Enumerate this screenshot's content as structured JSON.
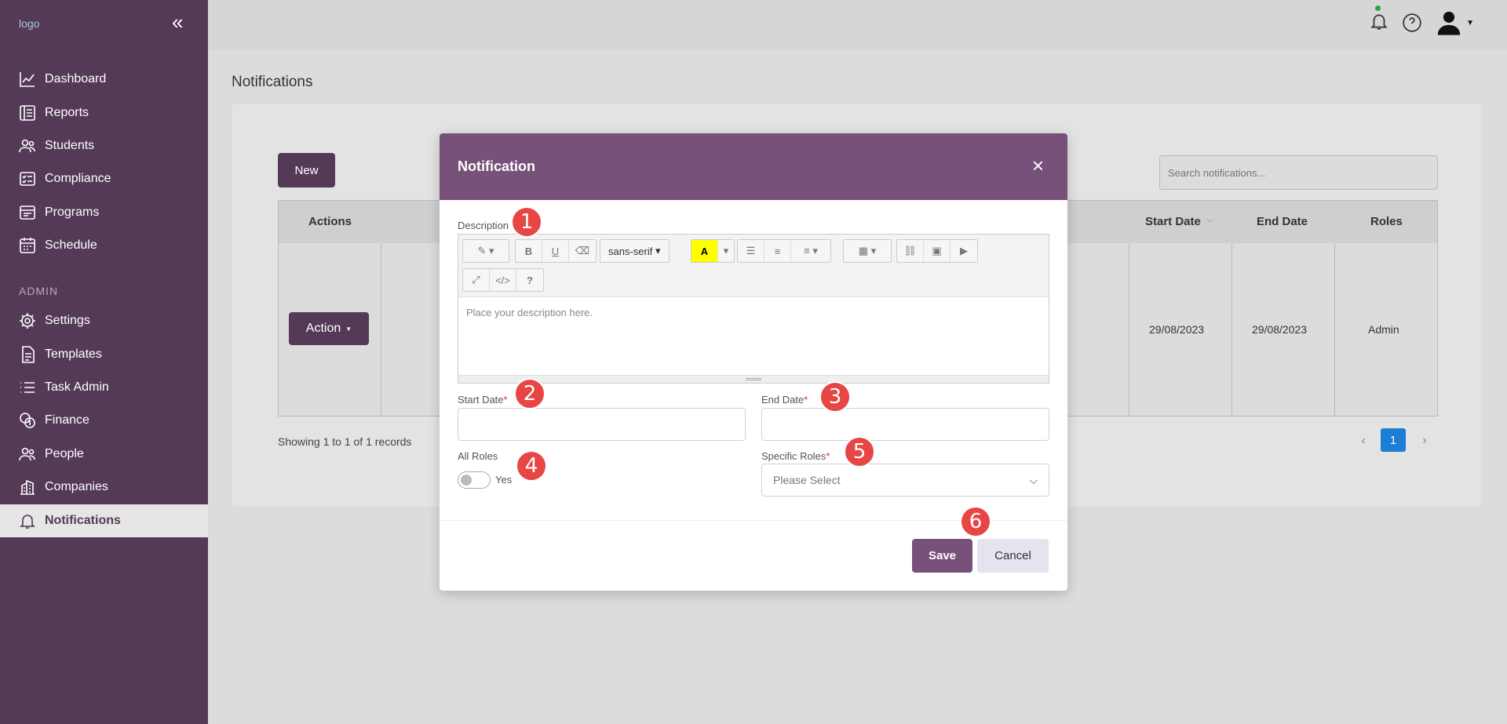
{
  "sidebar": {
    "logo_alt": "logo",
    "admin_label": "ADMIN",
    "items": [
      {
        "label": "Dashboard"
      },
      {
        "label": "Reports"
      },
      {
        "label": "Students"
      },
      {
        "label": "Compliance"
      },
      {
        "label": "Programs"
      },
      {
        "label": "Schedule"
      },
      {
        "label": "Settings"
      },
      {
        "label": "Templates"
      },
      {
        "label": "Task Admin"
      },
      {
        "label": "Finance"
      },
      {
        "label": "People"
      },
      {
        "label": "Companies"
      },
      {
        "label": "Notifications"
      }
    ],
    "active_item": "Notifications"
  },
  "page": {
    "title": "Notifications",
    "new_label": "New",
    "search_placeholder": "Search notifications...",
    "records": "Showing 1 to 1 of 1 records",
    "page_current": "1"
  },
  "table": {
    "headers": {
      "actions": "Actions",
      "start": "Start Date",
      "end": "End Date",
      "roles": "Roles"
    },
    "row": {
      "action_label": "Action",
      "start": "29/08/2023",
      "end": "29/08/2023",
      "roles": "Admin"
    }
  },
  "modal": {
    "title": "Notification",
    "description_label": "Description",
    "font_name": "sans-serif",
    "description_placeholder": "Place your description here.",
    "start_label": "Start Date",
    "end_label": "End Date",
    "all_roles_label": "All Roles",
    "toggle_text": "Yes",
    "specific_roles_label": "Specific Roles",
    "select_placeholder": "Please Select",
    "save_label": "Save",
    "cancel_label": "Cancel",
    "required_mark": "*"
  },
  "badges": [
    "1",
    "2",
    "3",
    "4",
    "5",
    "6"
  ],
  "colors": {
    "brand": "#553a57",
    "modal_header": "#78517a",
    "badge": "#e84545",
    "page_current": "#1c7ed6"
  }
}
